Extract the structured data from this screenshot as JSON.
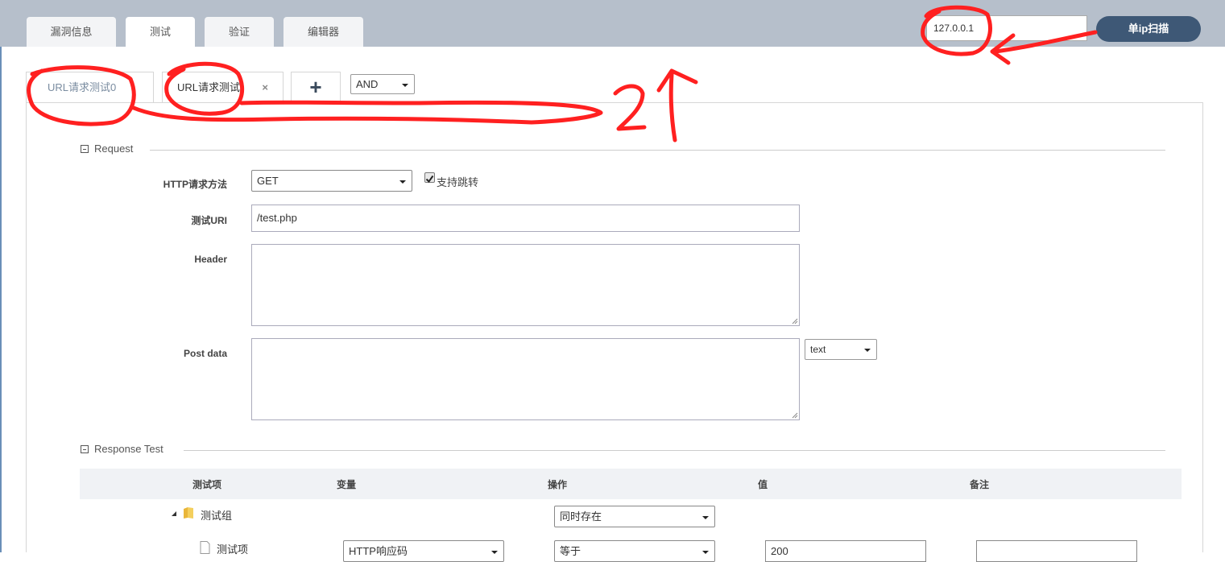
{
  "main_tabs": [
    {
      "label": "漏洞信息",
      "active": false
    },
    {
      "label": "测试",
      "active": true
    },
    {
      "label": "验证",
      "active": false
    },
    {
      "label": "编辑器",
      "active": false
    }
  ],
  "ip_input": {
    "value": "127.0.0.1"
  },
  "scan_button": {
    "label": "单ip扫描"
  },
  "sub_tabs": [
    {
      "label": "URL请求测试0"
    },
    {
      "label": "URL请求测试",
      "close": "×"
    }
  ],
  "add_tab": {
    "label": "+"
  },
  "logic_select": {
    "value": "AND"
  },
  "request": {
    "legend": "Request",
    "method_label": "HTTP请求方法",
    "method_value": "GET",
    "redirect_label": "支持跳转",
    "redirect_checked": true,
    "uri_label": "测试URI",
    "uri_value": "/test.php",
    "header_label": "Header",
    "header_value": "",
    "post_label": "Post data",
    "post_value": "",
    "post_type": "text"
  },
  "response": {
    "legend": "Response Test",
    "columns": [
      "测试项",
      "变量",
      "操作",
      "值",
      "备注"
    ],
    "group_label": "测试组",
    "group_op": "同时存在",
    "item_label": "测试项",
    "item_variable": "HTTP响应码",
    "item_op": "等于",
    "item_value": "200",
    "item_note": ""
  },
  "annotation": {
    "text": "2个",
    "color": "#ff2020"
  }
}
